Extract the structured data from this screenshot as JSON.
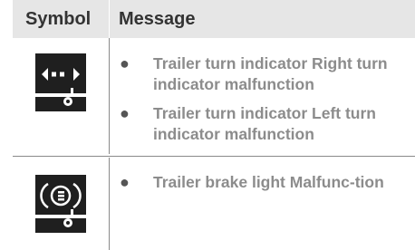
{
  "table": {
    "headers": {
      "symbol": "Symbol",
      "message": "Message"
    },
    "rows": [
      {
        "symbol_icon": "trailer-turn-indicator-icon",
        "messages": [
          "Trailer turn indicator Right turn indicator malfunction",
          "Trailer turn indicator Left turn indicator malfunction"
        ]
      },
      {
        "symbol_icon": "trailer-brake-light-icon",
        "messages": [
          "Trailer brake light Malfunc-tion"
        ]
      }
    ]
  },
  "colors": {
    "header_background": "#e6e6e6",
    "icon_background": "#1f1f1f",
    "message_text": "#8c8c8c"
  }
}
